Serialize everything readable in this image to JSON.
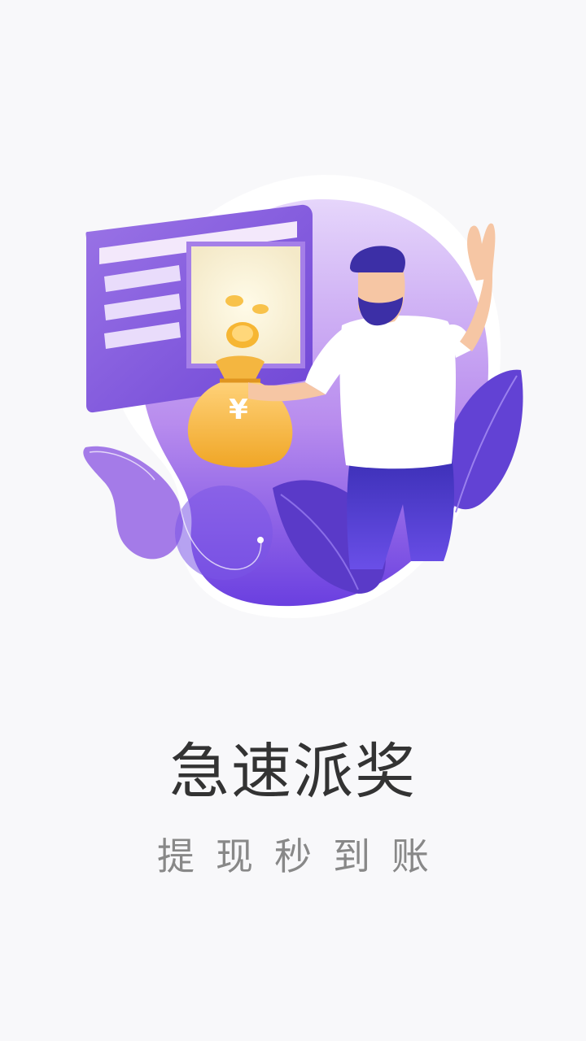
{
  "splash": {
    "title": "急速派奖",
    "subtitle": "提现秒到账",
    "bag_symbol": "¥"
  },
  "colors": {
    "background": "#f8f8fa",
    "primary_purple": "#7b4fe0",
    "light_purple": "#c9a8f0",
    "gold": "#f3b53f",
    "title_text": "#333333",
    "subtitle_text": "#888888"
  }
}
